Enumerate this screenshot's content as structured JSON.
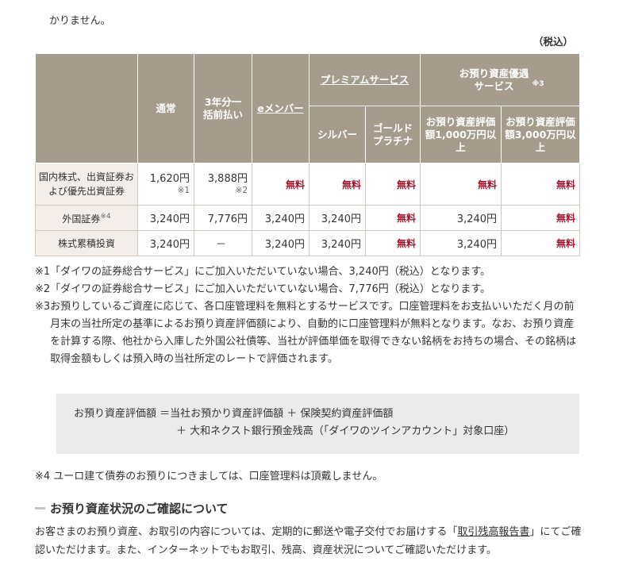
{
  "intro": {
    "line1": "　　　　　　　　　　　　　　　　　　　　　　　　　　　　　　　　　　　　",
    "line2": "かりません。"
  },
  "tax_note": "（税込）",
  "table": {
    "headers": {
      "normal": "通常",
      "three_year": "3年分一括前払い",
      "e_member": "eメンバー",
      "premium": "プレミアムサービス",
      "silver": "シルバー",
      "gold": "ゴールドプラチナ",
      "asset_service": "お預り資産優遇サービス",
      "asset_service_note": "※3",
      "tier1": "お預り資産評価額1,000万円以上",
      "tier2": "お預り資産評価額3,000万円以上"
    },
    "rows": [
      {
        "label": "国内株式、出資証券および優先出資証券",
        "normal": "1,620円",
        "normal_note": "※1",
        "three_year": "3,888円",
        "three_year_note": "※2",
        "e_member": "無料",
        "silver": "無料",
        "gold": "無料",
        "tier1": "無料",
        "tier2": "無料"
      },
      {
        "label": "外国証券",
        "label_note": "※4",
        "normal": "3,240円",
        "three_year": "7,776円",
        "e_member": "3,240円",
        "silver": "3,240円",
        "gold": "無料",
        "tier1": "3,240円",
        "tier2": "無料"
      },
      {
        "label": "株式累積投資",
        "normal": "3,240円",
        "three_year": "－",
        "e_member": "3,240円",
        "silver": "3,240円",
        "gold": "無料",
        "tier1": "3,240円",
        "tier2": "無料"
      }
    ]
  },
  "notes": [
    {
      "mark": "※1",
      "text": "「ダイワの証券総合サービス」にご加入いただいていない場合、3,240円（税込）となります。"
    },
    {
      "mark": "※2",
      "text": "「ダイワの証券総合サービス」にご加入いただいていない場合、7,776円（税込）となります。"
    },
    {
      "mark": "※3",
      "text": "お預りしているご資産に応じて、各口座管理料を無料とするサービスです。口座管理料をお支払いいただく月の前月末の当社所定の基準によるお預り資産評価額により、自動的に口座管理料が無料となります。なお、お預り資産を計算する際、他社から入庫した外国公社債等、当社が評価単価を取得できない銘柄をお持ちの場合、その銘柄は取得金額もしくは預入時の当社所定のレートで評価されます。"
    }
  ],
  "formula": {
    "line1": "お預り資産評価額 ＝当社お預かり資産評価額 ＋ 保険契約資産評価額",
    "line2": "＋ 大和ネクスト銀行預金残高（「ダイワのツインアカウント」対象口座）"
  },
  "note4": "※4 ユーロ建て債券のお預りにつきましては、口座管理料は頂戴しません。",
  "section": {
    "title": "お預り資産状況のご確認について",
    "body_pre": "お客さまのお預り資産、お取引の内容については、定期的に郵送や電子交付でお届けする「",
    "body_link": "取引残高報告書",
    "body_post": "」にてご確認いただけます。また、インターネットでもお取引、残高、資産状況についてご確認いただけます。"
  },
  "colors": {
    "header_bg": "#a59c8e",
    "row_header_bg": "#f3eeea",
    "free_text": "#a0172f",
    "formula_bg": "#ebebeb"
  }
}
